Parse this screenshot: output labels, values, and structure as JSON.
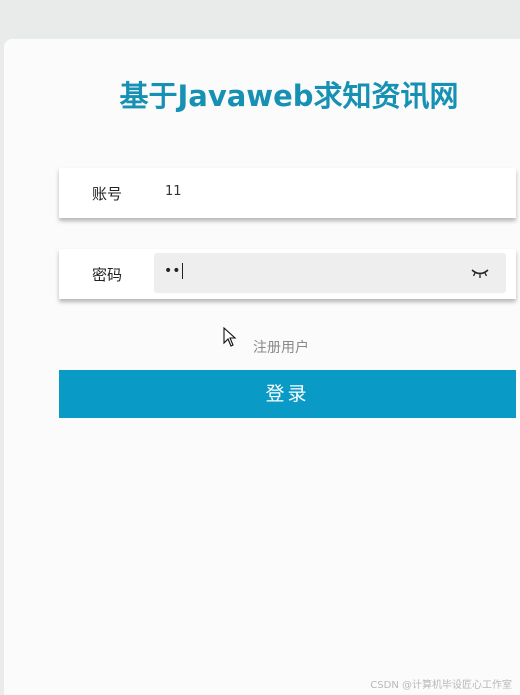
{
  "title": "基于Javaweb求知资讯网",
  "account": {
    "label": "账号",
    "value": "11"
  },
  "password": {
    "label": "密码",
    "value": "••"
  },
  "register_link": "注册用户",
  "login_button": "登录",
  "watermark": "CSDN @计算机毕设匠心工作室",
  "colors": {
    "accent": "#0a9ac6",
    "title": "#1691b4"
  }
}
